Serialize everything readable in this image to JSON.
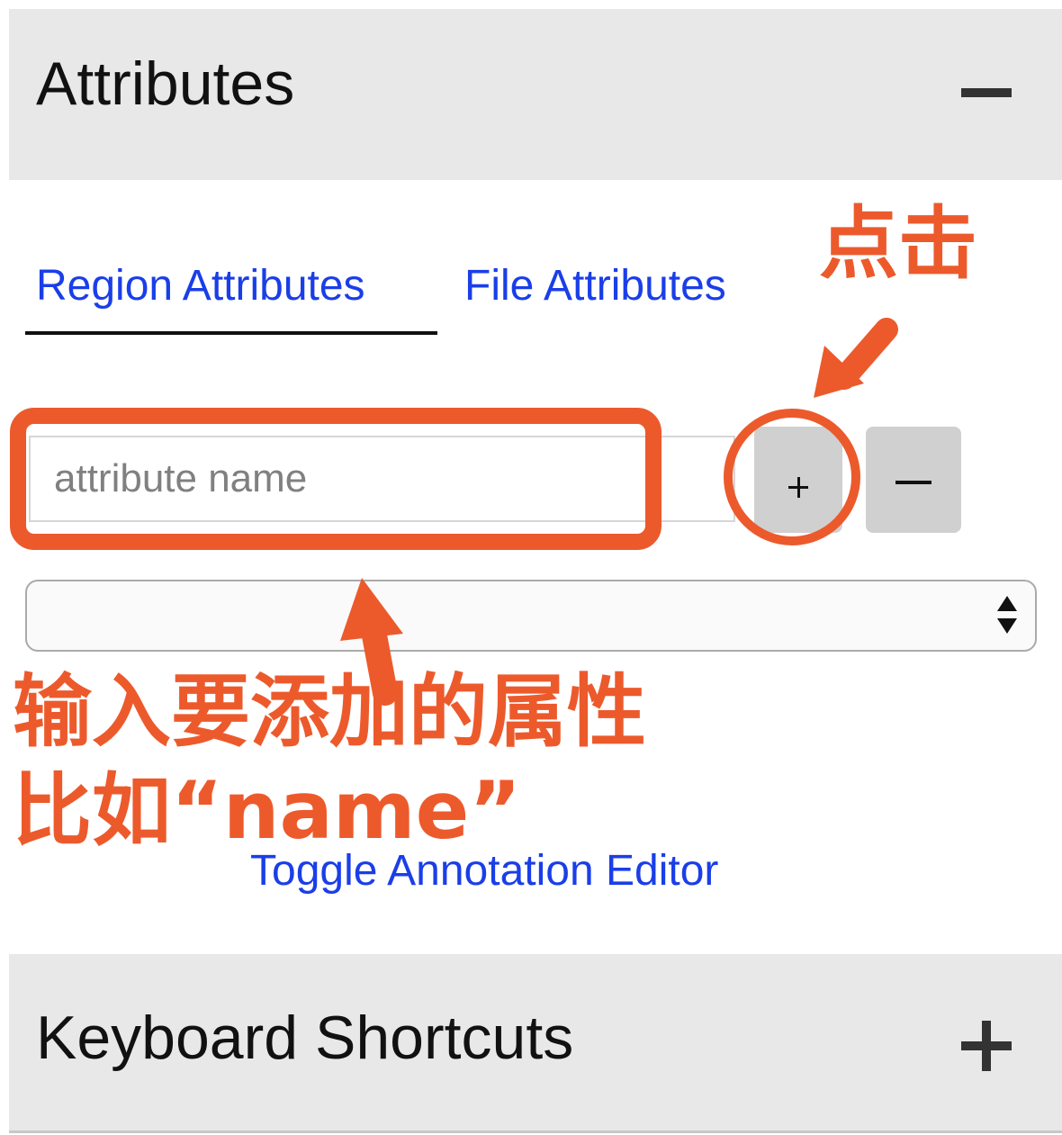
{
  "attributes_section": {
    "title": "Attributes",
    "toggle_icon": "minus-icon"
  },
  "tabs": [
    {
      "label": "Region Attributes",
      "active": true
    },
    {
      "label": "File Attributes",
      "active": false
    }
  ],
  "attribute_input": {
    "value": "",
    "placeholder": "attribute name"
  },
  "buttons": {
    "add_icon": "plus-icon",
    "remove_icon": "minus-icon"
  },
  "attribute_select": {
    "selected": ""
  },
  "toggle_link": "Toggle Annotation Editor",
  "keyboard_section": {
    "title": "Keyboard Shortcuts",
    "toggle_icon": "plus-icon"
  },
  "annotations": {
    "click_hint": "点击",
    "input_hint_line1": "输入要添加的属性",
    "input_hint_line2": "比如“name”",
    "color": "#ec5a2c"
  },
  "colors": {
    "link": "#1a3ee8",
    "header_bg": "#e8e8e8",
    "button_bg": "#d0d0d0"
  }
}
